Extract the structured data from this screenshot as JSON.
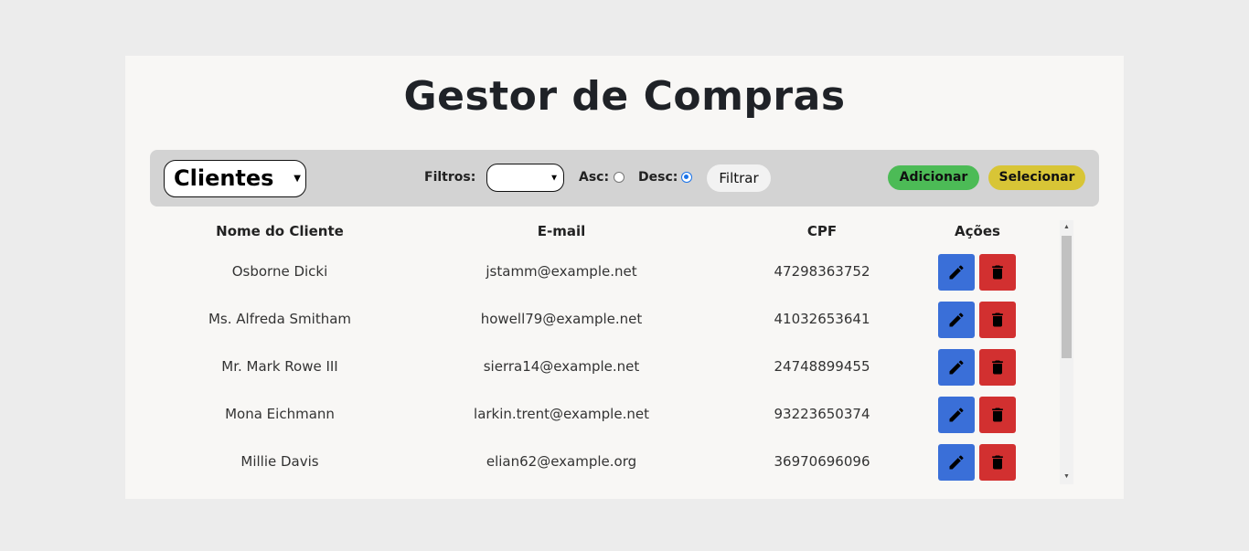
{
  "title": "Gestor de Compras",
  "toolbar": {
    "entity_select_value": "Clientes",
    "filters_label": "Filtros:",
    "filter_select_value": "",
    "asc_label": "Asc:",
    "desc_label": "Desc:",
    "order_selected": "desc",
    "filter_button": "Filtrar",
    "add_button": "Adicionar",
    "select_button": "Selecionar",
    "colors": {
      "add": "#4cbb56",
      "select": "#d8c536"
    }
  },
  "table": {
    "headers": [
      "Nome do Cliente",
      "E-mail",
      "CPF",
      "Ações"
    ],
    "rows": [
      {
        "name": "Osborne Dicki",
        "email": "jstamm@example.net",
        "cpf": "47298363752"
      },
      {
        "name": "Ms. Alfreda Smitham",
        "email": "howell79@example.net",
        "cpf": "41032653641"
      },
      {
        "name": "Mr. Mark Rowe III",
        "email": "sierra14@example.net",
        "cpf": "24748899455"
      },
      {
        "name": "Mona Eichmann",
        "email": "larkin.trent@example.net",
        "cpf": "93223650374"
      },
      {
        "name": "Millie Davis",
        "email": "elian62@example.org",
        "cpf": "36970696096"
      }
    ],
    "actions": {
      "edit_icon": "pencil-icon",
      "delete_icon": "trash-icon",
      "edit_color": "#3a6fd8",
      "delete_color": "#d23030"
    }
  }
}
